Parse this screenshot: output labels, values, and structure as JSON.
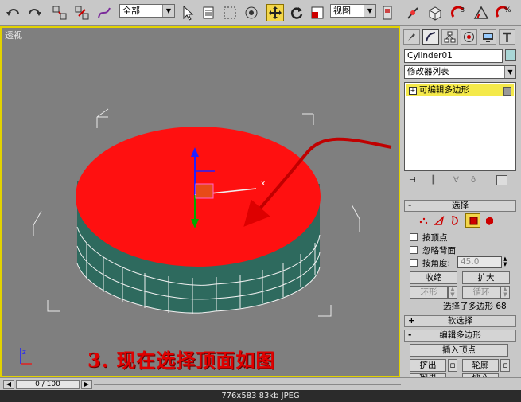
{
  "toolbar": {
    "selection_filter": "全部",
    "coord_system": "视图"
  },
  "viewport": {
    "label": "透视",
    "caption": "3. 现在选择顶面如图"
  },
  "panel": {
    "object_name": "Cylinder01",
    "object_color": "#a9d6d6",
    "modifier_list": "修改器列表",
    "stack_item": "可编辑多边形",
    "selection_rollout": "选择",
    "by_vertex": "按顶点",
    "ignore_backfacing": "忽略背面",
    "by_angle": "按角度:",
    "angle_value": "45.0",
    "shrink": "收缩",
    "grow": "扩大",
    "ring": "环形",
    "loop": "循环",
    "selected_info": "选择了多边形 68",
    "soft_selection": "软选择",
    "edit_polygons": "编辑多边形",
    "insert_vertex": "插入顶点",
    "extrude": "挤出",
    "outline": "轮廓",
    "bevel": "倒角",
    "inset": "插入"
  },
  "status": {
    "frame": "0 / 100"
  },
  "info_bar": "776x583 83kb JPEG",
  "colors": {
    "top_face": "#ff1010",
    "side_face": "#2e6a5e",
    "viewport_bg": "#7f7f7f",
    "active_border": "#e2d200"
  }
}
